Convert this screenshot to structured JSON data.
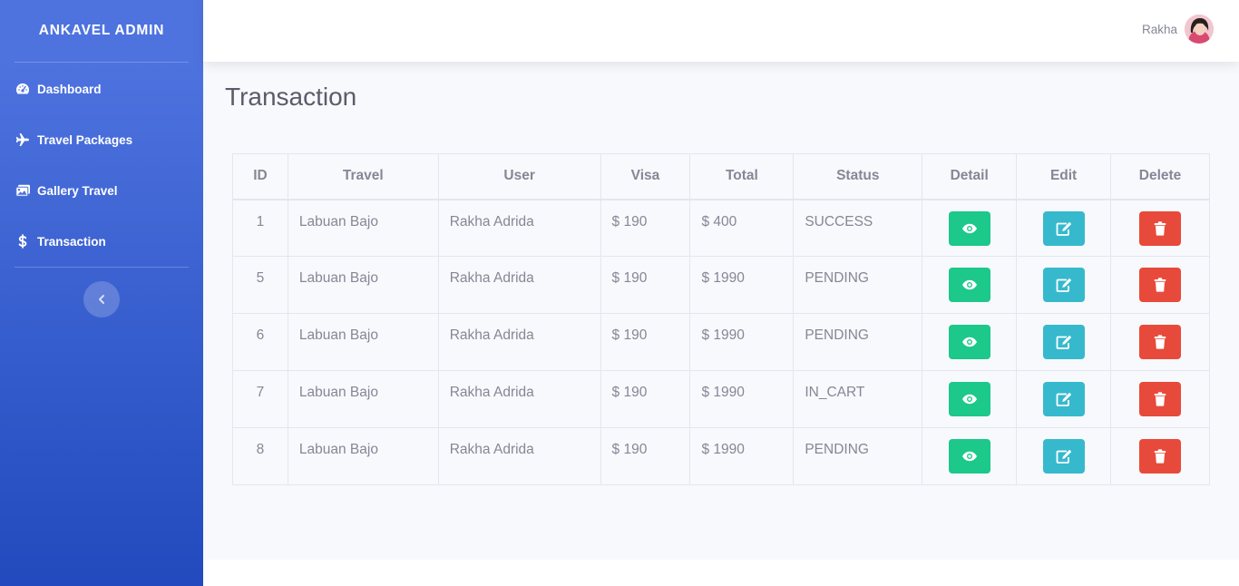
{
  "sidebar": {
    "brand": "ANKAVEL ADMIN",
    "items": [
      {
        "label": "Dashboard",
        "icon": "tachometer-icon"
      },
      {
        "label": "Travel Packages",
        "icon": "plane-icon"
      },
      {
        "label": "Gallery Travel",
        "icon": "images-icon"
      },
      {
        "label": "Transaction",
        "icon": "dollar-icon"
      }
    ],
    "toggle_icon": "chevron-left-icon"
  },
  "topbar": {
    "user_name": "Rakha"
  },
  "page": {
    "title": "Transaction"
  },
  "table": {
    "headers": [
      "ID",
      "Travel",
      "User",
      "Visa",
      "Total",
      "Status",
      "Detail",
      "Edit",
      "Delete"
    ],
    "rows": [
      {
        "id": "1",
        "travel": "Labuan Bajo",
        "user": "Rakha Adrida",
        "visa": "$ 190",
        "total": "$ 400",
        "status": "SUCCESS"
      },
      {
        "id": "5",
        "travel": "Labuan Bajo",
        "user": "Rakha Adrida",
        "visa": "$ 190",
        "total": "$ 1990",
        "status": "PENDING"
      },
      {
        "id": "6",
        "travel": "Labuan Bajo",
        "user": "Rakha Adrida",
        "visa": "$ 190",
        "total": "$ 1990",
        "status": "PENDING"
      },
      {
        "id": "7",
        "travel": "Labuan Bajo",
        "user": "Rakha Adrida",
        "visa": "$ 190",
        "total": "$ 1990",
        "status": "IN_CART"
      },
      {
        "id": "8",
        "travel": "Labuan Bajo",
        "user": "Rakha Adrida",
        "visa": "$ 190",
        "total": "$ 1990",
        "status": "PENDING"
      }
    ]
  },
  "colors": {
    "sidebar_start": "#4e73df",
    "sidebar_end": "#224abe",
    "detail_button": "#1cc88a",
    "edit_button": "#36b9cc",
    "delete_button": "#e74a3b",
    "text_muted": "#858796"
  }
}
